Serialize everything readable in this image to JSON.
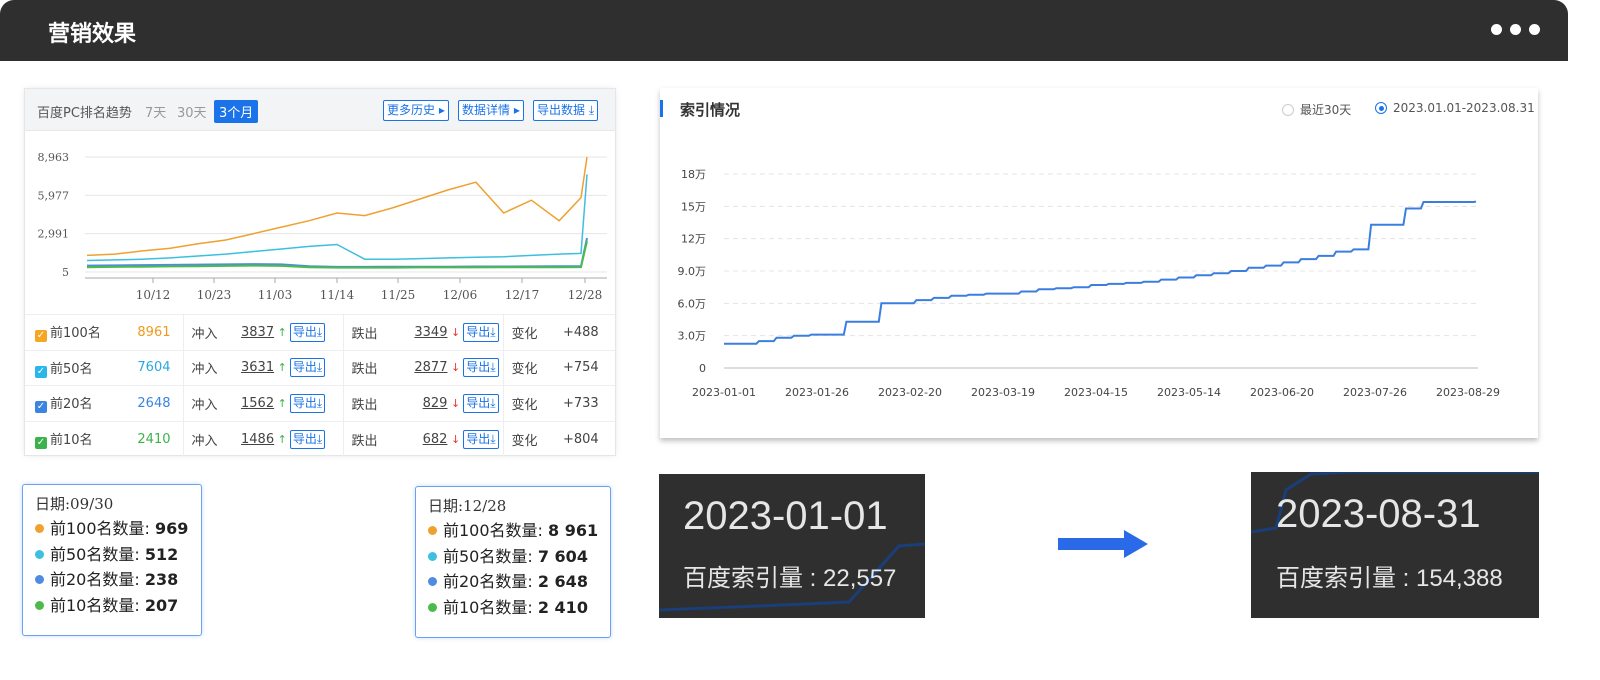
{
  "header": {
    "title": "营销效果",
    "more_icon": "ellipsis-icon"
  },
  "ranking": {
    "title": "百度PC排名趋势",
    "tabs": [
      "7天",
      "30天",
      "3个月"
    ],
    "active_tab": "3个月",
    "buttons": {
      "history": "更多历史 ▸",
      "detail": "数据详情 ▸",
      "export": "导出数据 ⤓"
    },
    "chart_data": {
      "type": "line",
      "yticks": [
        "8,963",
        "5,977",
        "2,991",
        "5"
      ],
      "ylim": [
        5,
        8963
      ],
      "xticks": [
        "10/12",
        "10/23",
        "11/03",
        "11/14",
        "11/25",
        "12/06",
        "12/17",
        "12/28"
      ],
      "series": [
        {
          "name": "前100名",
          "color": "#f0a030",
          "values": [
            1300,
            1400,
            1650,
            1850,
            2200,
            2500,
            3000,
            3500,
            4000,
            4600,
            4400,
            5000,
            5700,
            6400,
            7000,
            4600,
            5600,
            4000,
            5800,
            8963
          ]
        },
        {
          "name": "前50名",
          "color": "#3dbfe0",
          "values": [
            900,
            950,
            1000,
            1100,
            1250,
            1400,
            1600,
            1800,
            2000,
            2150,
            1000,
            1000,
            1050,
            1100,
            1150,
            1200,
            1300,
            1400,
            1450,
            7604
          ]
        },
        {
          "name": "前20名",
          "color": "#4f8be0",
          "values": [
            500,
            520,
            540,
            560,
            580,
            600,
            620,
            600,
            450,
            400,
            400,
            420,
            420,
            420,
            430,
            430,
            440,
            450,
            460,
            2648
          ]
        },
        {
          "name": "前10名",
          "color": "#4cbb4c",
          "values": [
            380,
            400,
            420,
            440,
            460,
            480,
            500,
            480,
            380,
            350,
            350,
            350,
            360,
            360,
            360,
            370,
            370,
            380,
            390,
            2410
          ]
        }
      ]
    },
    "rows": [
      {
        "label": "前100名",
        "checkbox_color": "#f5a623",
        "total": "8961",
        "total_color": "#f09a1a",
        "in_label": "冲入",
        "in_val": "3837",
        "out_label": "跌出",
        "out_val": "3349",
        "export": "导出⤓",
        "chg_label": "变化",
        "chg": "+488"
      },
      {
        "label": "前50名",
        "checkbox_color": "#29b6e8",
        "total": "7604",
        "total_color": "#29a8e0",
        "in_label": "冲入",
        "in_val": "3631",
        "out_label": "跌出",
        "out_val": "2877",
        "export": "导出⤓",
        "chg_label": "变化",
        "chg": "+754"
      },
      {
        "label": "前20名",
        "checkbox_color": "#3a85e0",
        "total": "2648",
        "total_color": "#3a85e0",
        "in_label": "冲入",
        "in_val": "1562",
        "out_label": "跌出",
        "out_val": "829",
        "export": "导出⤓",
        "chg_label": "变化",
        "chg": "+733"
      },
      {
        "label": "前10名",
        "checkbox_color": "#3bb34a",
        "total": "2410",
        "total_color": "#3bb34a",
        "in_label": "冲入",
        "in_val": "1486",
        "out_label": "跌出",
        "out_val": "682",
        "export": "导出⤓",
        "chg_label": "变化",
        "chg": "+804"
      }
    ]
  },
  "tooltip_left": {
    "date": "日期:09/30",
    "rows": [
      {
        "label": "前100名数量: ",
        "value": "969",
        "color": "#f0a030"
      },
      {
        "label": "前50名数量: ",
        "value": "512",
        "color": "#3dbfe0"
      },
      {
        "label": "前20名数量: ",
        "value": "238",
        "color": "#4f8be0"
      },
      {
        "label": "前10名数量: ",
        "value": "207",
        "color": "#4cbb4c"
      }
    ]
  },
  "tooltip_right": {
    "date": "日期:12/28",
    "rows": [
      {
        "label": "前100名数量: ",
        "value": "8 961",
        "color": "#f0a030"
      },
      {
        "label": "前50名数量: ",
        "value": "7 604",
        "color": "#3dbfe0"
      },
      {
        "label": "前20名数量: ",
        "value": "2 648",
        "color": "#4f8be0"
      },
      {
        "label": "前10名数量: ",
        "value": "2 410",
        "color": "#4cbb4c"
      }
    ]
  },
  "index": {
    "title": "索引情况",
    "radio_30": "最近30天",
    "radio_range": "2023.01.01-2023.08.31",
    "chart_data": {
      "type": "line",
      "color": "#3a7fe0",
      "yticks": [
        "18万",
        "15万",
        "12万",
        "9.0万",
        "6.0万",
        "3.0万",
        "0"
      ],
      "ylim": [
        0,
        180000
      ],
      "xticks": [
        "2023-01-01",
        "2023-01-26",
        "2023-02-20",
        "2023-03-19",
        "2023-04-15",
        "2023-05-14",
        "2023-06-20",
        "2023-07-26",
        "2023-08-29"
      ],
      "values": [
        22557,
        22557,
        25000,
        28000,
        30000,
        31000,
        31000,
        43000,
        43000,
        60000,
        60000,
        63000,
        65000,
        67000,
        68000,
        69000,
        69000,
        71000,
        73000,
        74000,
        75000,
        77000,
        78000,
        79000,
        80000,
        82000,
        84000,
        86000,
        88000,
        90000,
        93000,
        95000,
        98000,
        101000,
        104000,
        108000,
        110000,
        133000,
        133000,
        148000,
        154000,
        154000,
        154000,
        154388
      ]
    }
  },
  "callout_start": {
    "date": "2023-01-01",
    "text": "百度索引量 : 22,557"
  },
  "callout_end": {
    "date": "2023-08-31",
    "text": "百度索引量 : 154,388"
  }
}
